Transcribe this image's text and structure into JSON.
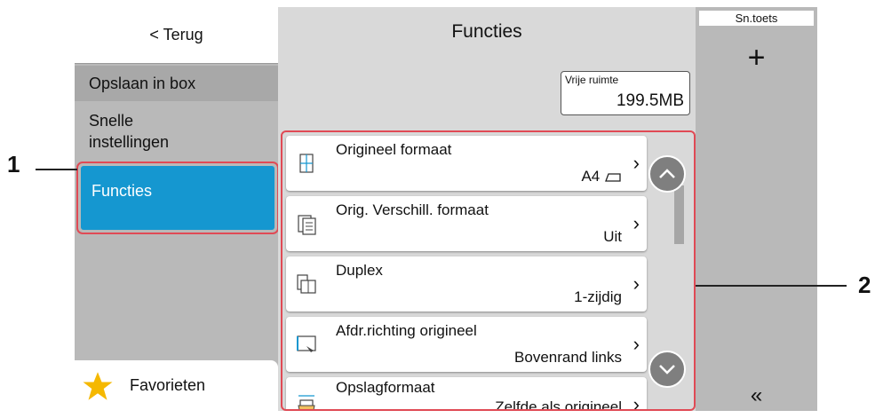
{
  "sidebar": {
    "back_label": "< Terug",
    "items": [
      {
        "label": "Opslaan in box"
      },
      {
        "label": "Snelle\ninstellingen"
      },
      {
        "label": "Functies"
      }
    ],
    "favorites_label": "Favorieten"
  },
  "main": {
    "title": "Functies",
    "free_space": {
      "label": "Vrije ruimte",
      "value": "199.5MB"
    },
    "functions": [
      {
        "name": "Origineel formaat",
        "value": "A4",
        "icon": "original-size-icon"
      },
      {
        "name": "Orig. Verschill. formaat",
        "value": "Uit",
        "icon": "mixed-size-icon"
      },
      {
        "name": "Duplex",
        "value": "1-zijdig",
        "icon": "duplex-icon"
      },
      {
        "name": "Afdr.richting origineel",
        "value": "Bovenrand links",
        "icon": "orientation-icon"
      },
      {
        "name": "Opslagformaat",
        "value": "Zelfde als origineel",
        "icon": "storing-size-icon"
      }
    ]
  },
  "quickkey": {
    "tab_label": "Sn.toets",
    "add_label": "+",
    "collapse_label": "«"
  },
  "callouts": [
    "1",
    "2"
  ],
  "colors": {
    "accent": "#1597d0",
    "highlight": "#e04a55",
    "panel": "#b9b9b9"
  }
}
